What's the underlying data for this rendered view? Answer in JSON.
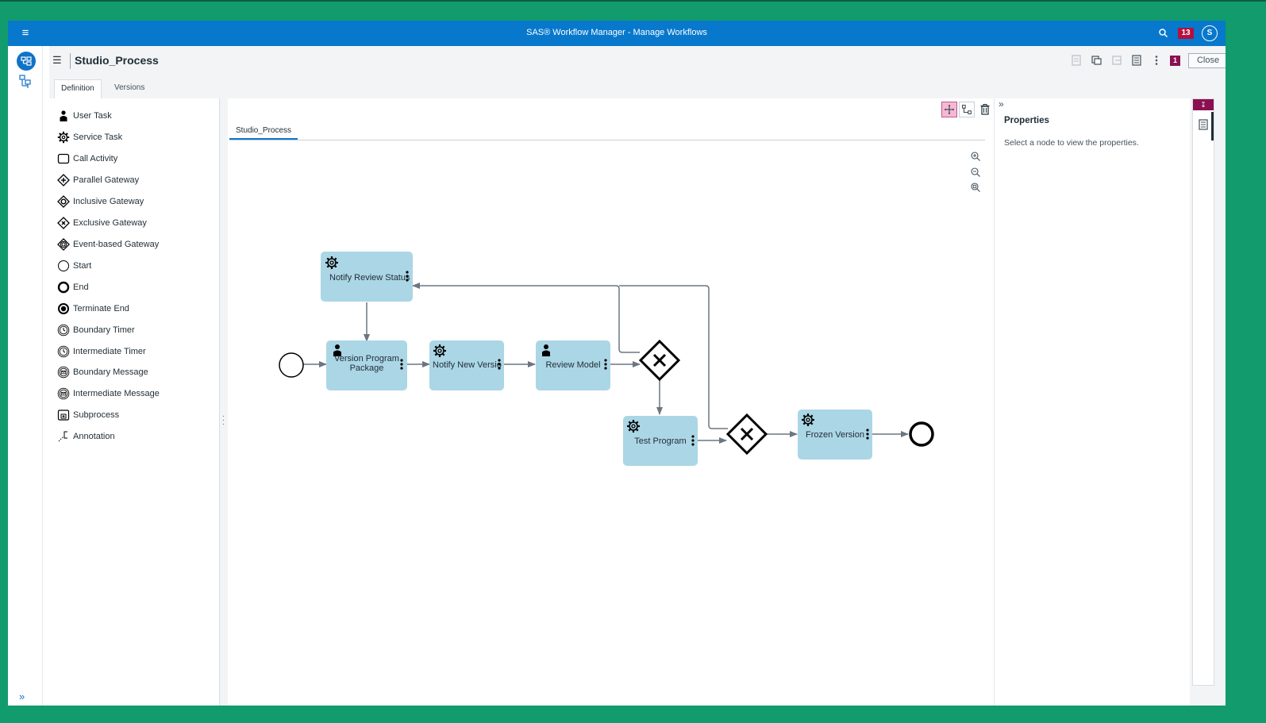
{
  "app": {
    "title": "SAS® Workflow Manager - Manage Workflows",
    "notification_count": "13",
    "user_initial": "S"
  },
  "page": {
    "title": "Studio_Process",
    "toolbar_badge": "1",
    "close_label": "Close"
  },
  "tabs": [
    {
      "label": "Definition",
      "active": true
    },
    {
      "label": "Versions",
      "active": false
    }
  ],
  "palette": [
    {
      "label": "User Task",
      "icon": "user-task-icon"
    },
    {
      "label": "Service Task",
      "icon": "service-task-icon"
    },
    {
      "label": "Call Activity",
      "icon": "call-activity-icon"
    },
    {
      "label": "Parallel Gateway",
      "icon": "parallel-gateway-icon"
    },
    {
      "label": "Inclusive Gateway",
      "icon": "inclusive-gateway-icon"
    },
    {
      "label": "Exclusive Gateway",
      "icon": "exclusive-gateway-icon"
    },
    {
      "label": "Event-based Gateway",
      "icon": "event-based-gateway-icon"
    },
    {
      "label": "Start",
      "icon": "start-event-icon"
    },
    {
      "label": "End",
      "icon": "end-event-icon"
    },
    {
      "label": "Terminate End",
      "icon": "terminate-end-icon"
    },
    {
      "label": "Boundary Timer",
      "icon": "boundary-timer-icon"
    },
    {
      "label": "Intermediate Timer",
      "icon": "intermediate-timer-icon"
    },
    {
      "label": "Boundary Message",
      "icon": "boundary-message-icon"
    },
    {
      "label": "Intermediate Message",
      "icon": "intermediate-message-icon"
    },
    {
      "label": "Subprocess",
      "icon": "subprocess-icon"
    },
    {
      "label": "Annotation",
      "icon": "annotation-icon"
    }
  ],
  "canvas": {
    "tab_label": "Studio_Process",
    "nodes": {
      "notify_review": {
        "label": "Notify Review Status",
        "type": "service"
      },
      "version_program": {
        "line1": "Version Program",
        "line2": "Package",
        "type": "user"
      },
      "notify_new": {
        "label": "Notify New Versio",
        "type": "service"
      },
      "review_model": {
        "label": "Review Model",
        "type": "user"
      },
      "test_program": {
        "label": "Test Program",
        "type": "service"
      },
      "frozen_version": {
        "label": "Frozen Version",
        "type": "service"
      }
    }
  },
  "properties": {
    "title": "Properties",
    "message": "Select a node to view the properties."
  }
}
